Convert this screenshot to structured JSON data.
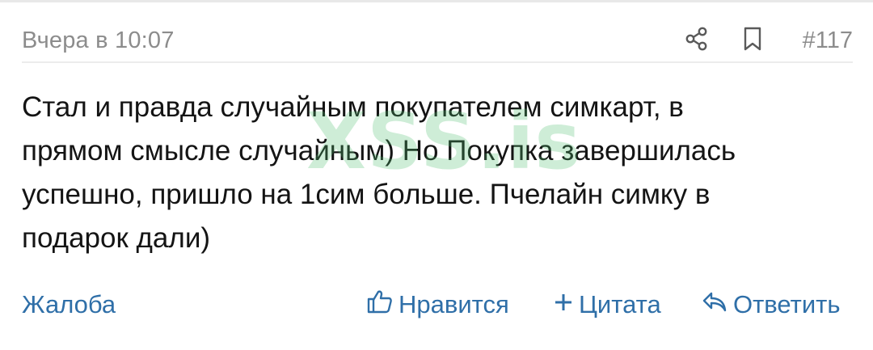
{
  "post": {
    "date": "Вчера в 10:07",
    "number": "#117",
    "body": "Стал и правда случайным покупателем симкарт, в\nпрямом смысле случайным) Но Покупка завершилась\nуспешно, пришло на 1сим больше. Пчелайн симку в\nподарок дали)",
    "watermark": "XSS.is"
  },
  "icons": {
    "share": "share-icon",
    "bookmark": "bookmark-icon",
    "like": "thumbs-up-icon",
    "quote": "plus-icon",
    "reply": "reply-icon"
  },
  "actions": {
    "report": "Жалоба",
    "like": "Нравится",
    "quote": "Цитата",
    "reply": "Ответить"
  },
  "colors": {
    "link": "#2f6fa8",
    "meta": "#8c8c8c",
    "text": "#141414",
    "watermark": "#50be6e"
  }
}
